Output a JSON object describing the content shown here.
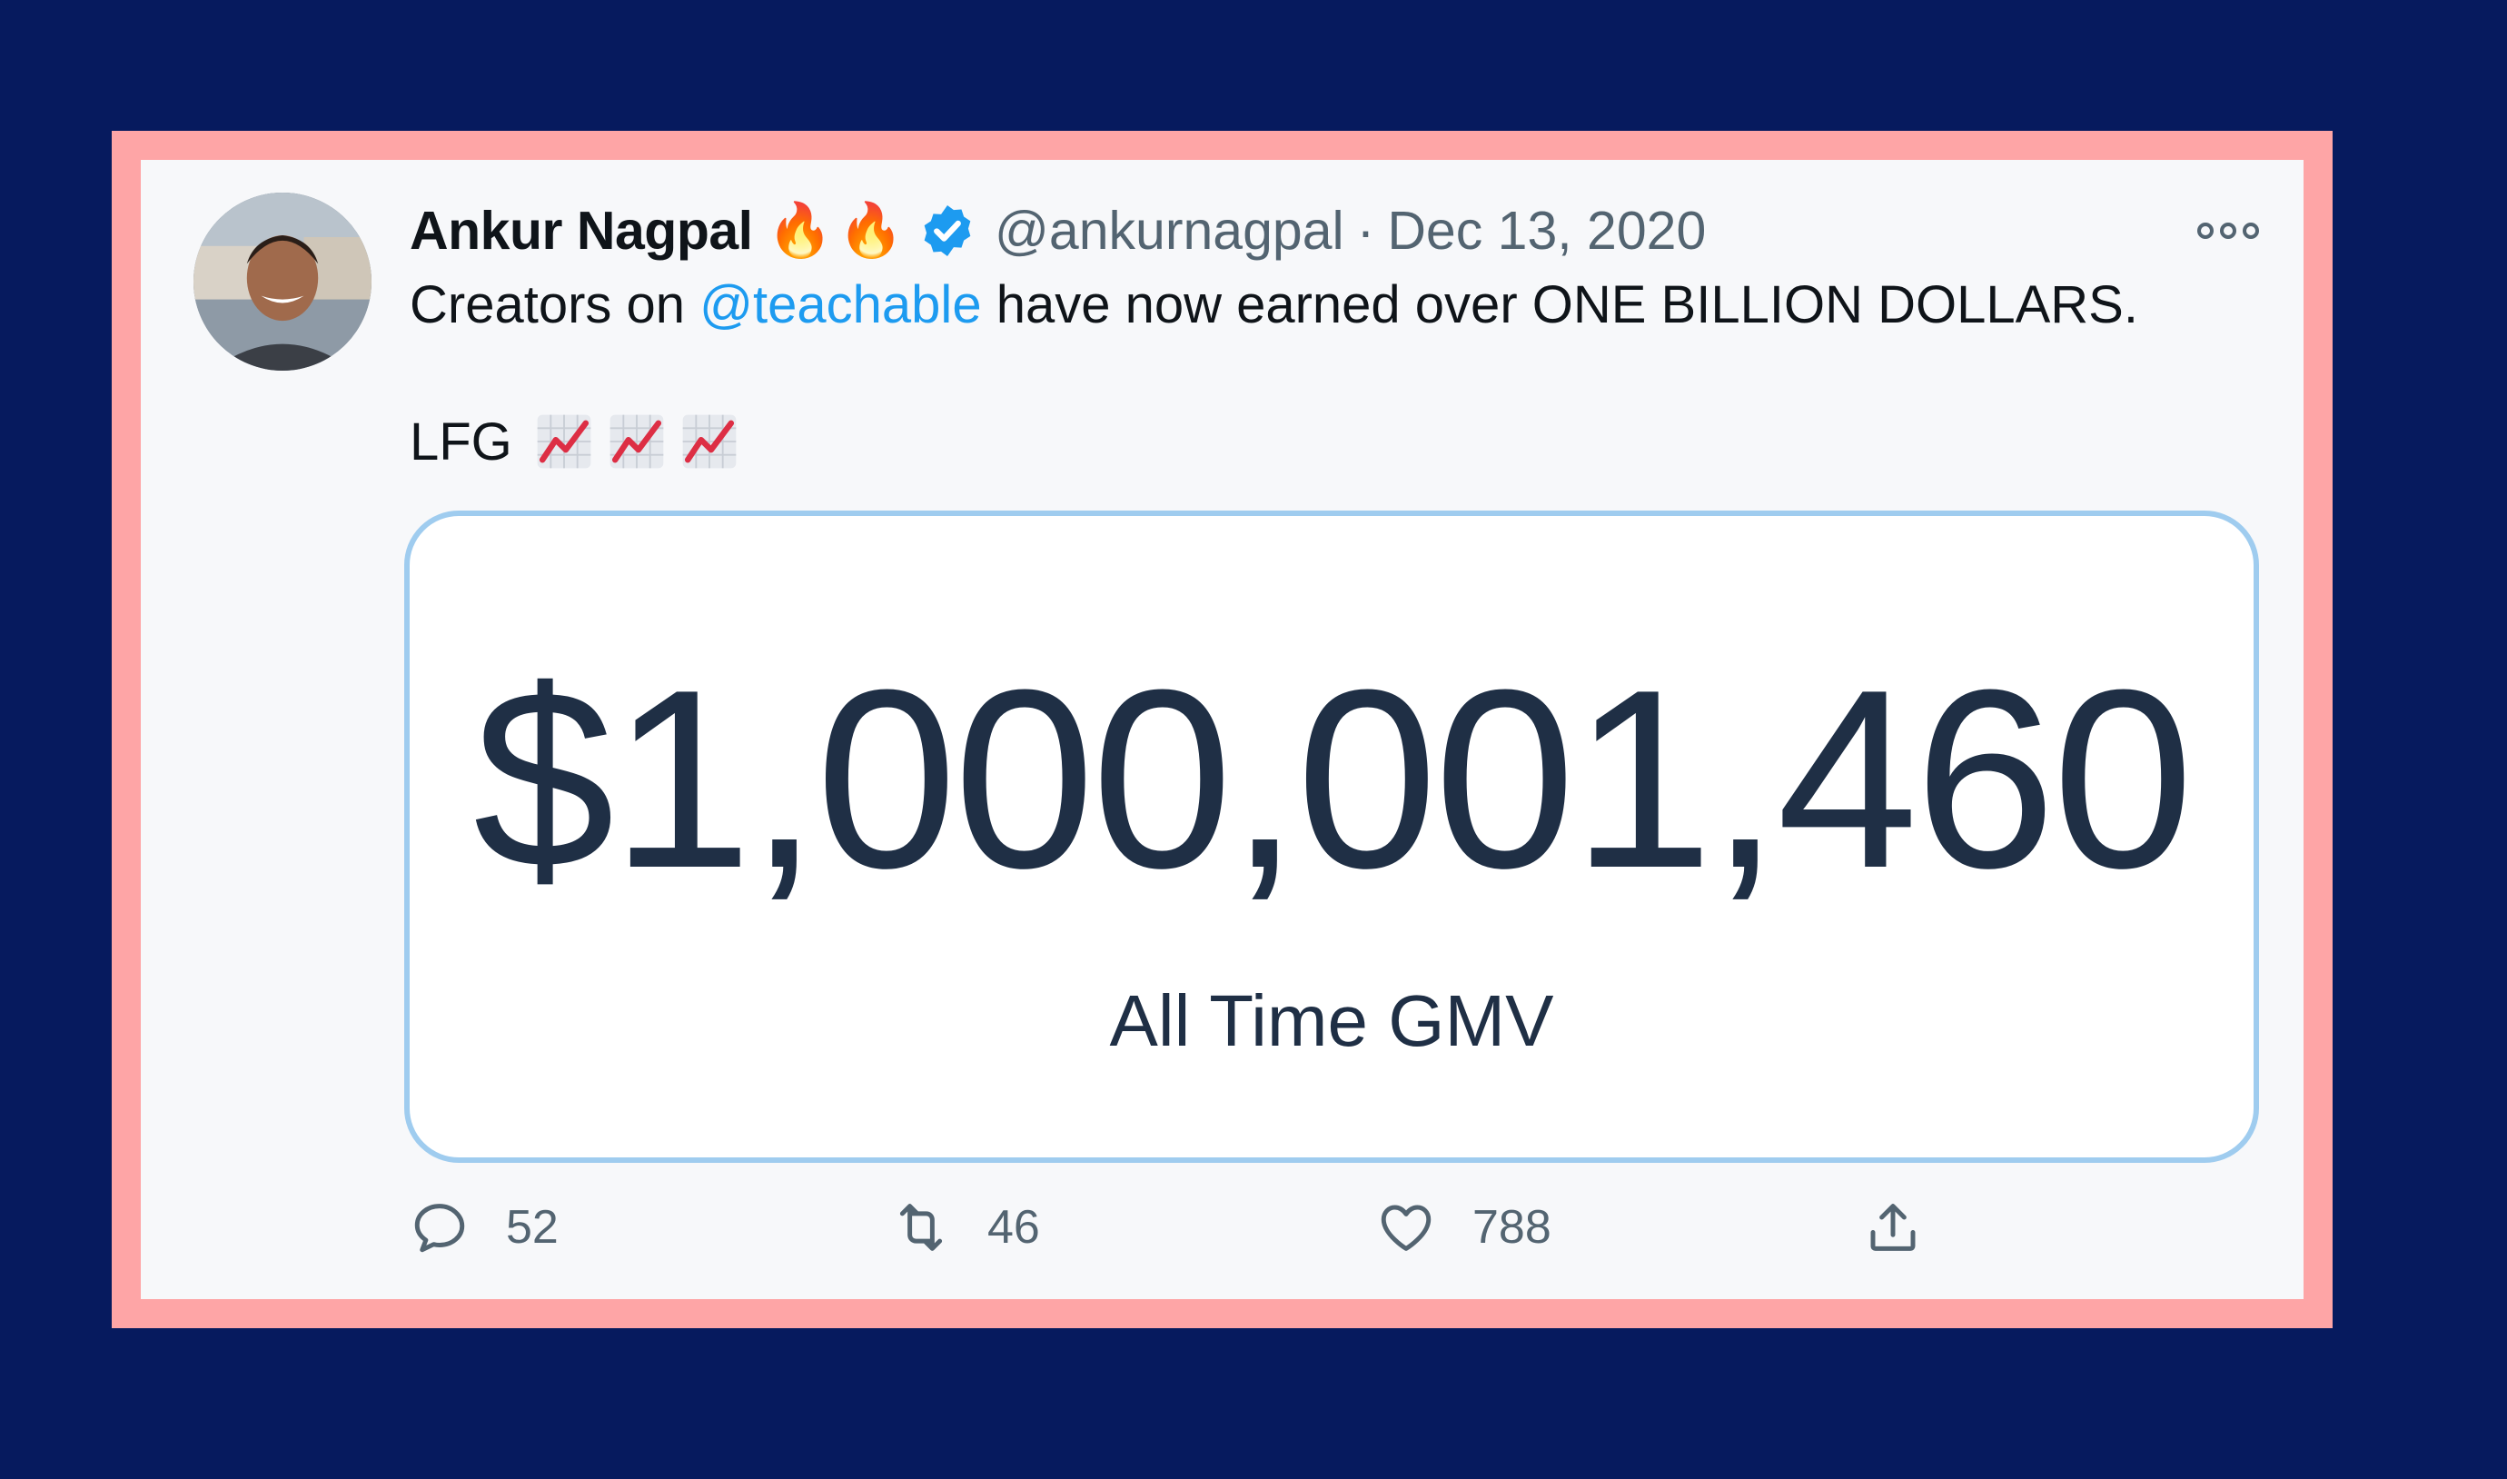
{
  "tweet": {
    "author_name": "Ankur Nagpal",
    "name_emojis": [
      "🔥",
      "🔥"
    ],
    "handle": "@ankurnagpal",
    "separator": "·",
    "date": "Dec 13, 2020",
    "text_before": "Creators on ",
    "mention": "@teachable",
    "text_after": " have now earned over ONE BILLION DOLLARS.",
    "line2": "LFG",
    "line2_emojis": [
      "chart-increasing-icon",
      "chart-increasing-icon",
      "chart-increasing-icon"
    ]
  },
  "media": {
    "amount": "$1,000,001,460",
    "label": "All Time GMV"
  },
  "actions": {
    "reply_count": "52",
    "retweet_count": "46",
    "like_count": "788"
  },
  "colors": {
    "background": "#061a5e",
    "frame": "#fea5a6",
    "card": "#f7f8fa",
    "mention": "#1d9bf0",
    "verified": "#1d9bf0",
    "amount_text": "#1f2f45",
    "media_border": "#9fccef"
  }
}
